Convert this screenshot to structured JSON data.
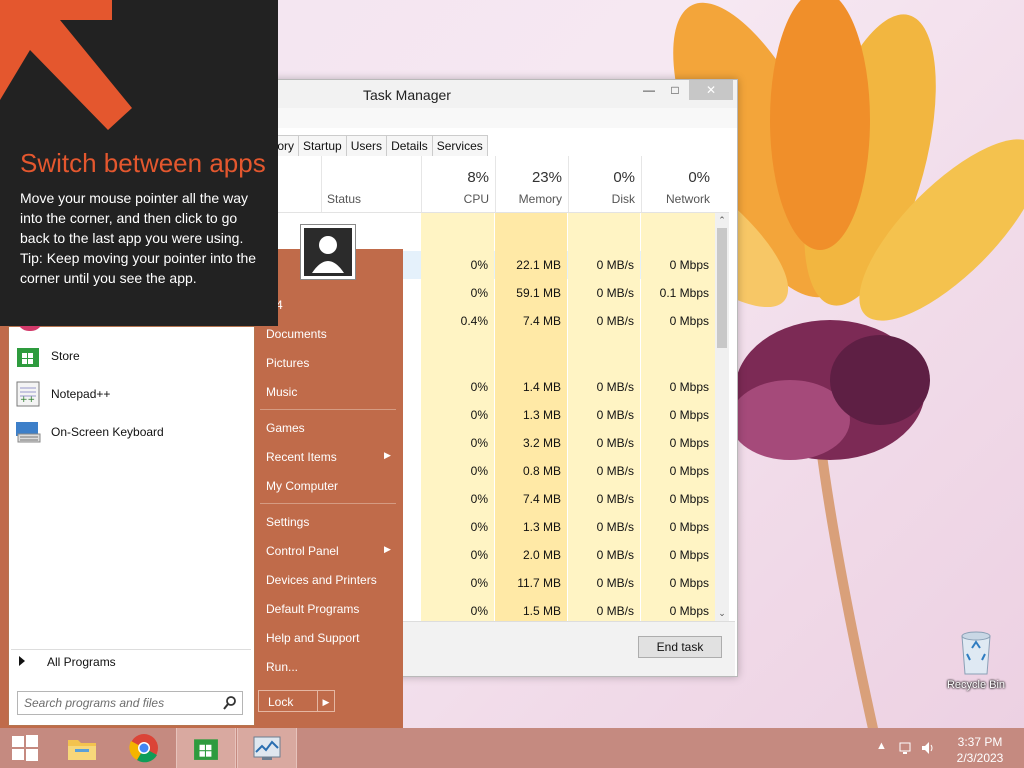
{
  "tip": {
    "title": "Switch between apps",
    "body": "Move your mouse pointer all the way into the corner, and then click to go back to the last app you were using.",
    "tip": "Tip: Keep moving your pointer into the corner until you see the app."
  },
  "task_manager": {
    "title": "Task Manager",
    "tabs": [
      "tory",
      "Startup",
      "Users",
      "Details",
      "Services"
    ],
    "columns": {
      "status": "Status",
      "cpu": {
        "pct": "8%",
        "label": "CPU"
      },
      "memory": {
        "pct": "23%",
        "label": "Memory"
      },
      "disk": {
        "pct": "0%",
        "label": "Disk"
      },
      "network": {
        "pct": "0%",
        "label": "Network"
      }
    },
    "rows": [
      {
        "cpu": "0%",
        "mem": "22.1 MB",
        "disk": "0 MB/s",
        "net": "0 Mbps"
      },
      {
        "cpu": "0%",
        "mem": "59.1 MB",
        "disk": "0 MB/s",
        "net": "0.1 Mbps"
      },
      {
        "cpu": "0.4%",
        "mem": "7.4 MB",
        "disk": "0 MB/s",
        "net": "0 Mbps"
      },
      {
        "cpu": "0%",
        "mem": "1.4 MB",
        "disk": "0 MB/s",
        "net": "0 Mbps"
      },
      {
        "cpu": "0%",
        "mem": "1.3 MB",
        "disk": "0 MB/s",
        "net": "0 Mbps"
      },
      {
        "cpu": "0%",
        "mem": "3.2 MB",
        "disk": "0 MB/s",
        "net": "0 Mbps"
      },
      {
        "cpu": "0%",
        "mem": "0.8 MB",
        "disk": "0 MB/s",
        "net": "0 Mbps"
      },
      {
        "cpu": "0%",
        "mem": "7.4 MB",
        "disk": "0 MB/s",
        "net": "0 Mbps"
      },
      {
        "cpu": "0%",
        "mem": "1.3 MB",
        "disk": "0 MB/s",
        "net": "0 Mbps"
      },
      {
        "cpu": "0%",
        "mem": "2.0 MB",
        "disk": "0 MB/s",
        "net": "0 Mbps"
      },
      {
        "cpu": "0%",
        "mem": "11.7 MB",
        "disk": "0 MB/s",
        "net": "0 Mbps"
      },
      {
        "cpu": "0%",
        "mem": "1.5 MB",
        "disk": "0 MB/s",
        "net": "0 Mbps"
      }
    ],
    "end_task": "End task"
  },
  "start_menu": {
    "programs": [
      "Store",
      "Notepad++",
      "On-Screen Keyboard"
    ],
    "all_programs": "All Programs",
    "search_placeholder": "Search programs and files",
    "right_items": {
      "user": "M4",
      "documents": "Documents",
      "pictures": "Pictures",
      "music": "Music",
      "games": "Games",
      "recent_items": "Recent Items",
      "my_computer": "My Computer",
      "settings": "Settings",
      "control_panel": "Control Panel",
      "devices_printers": "Devices and Printers",
      "default_programs": "Default Programs",
      "help_support": "Help and Support",
      "run": "Run..."
    },
    "lock": "Lock"
  },
  "desktop": {
    "recycle_bin": "Recycle Bin"
  },
  "taskbar": {
    "time": "3:37 PM",
    "date": "2/3/2023"
  },
  "colors": {
    "accent_orange": "#e4572e",
    "start_menu_right": "#c06b4a",
    "taskbar": "#c58a80",
    "memory_highlight": "#ffe9a6"
  }
}
